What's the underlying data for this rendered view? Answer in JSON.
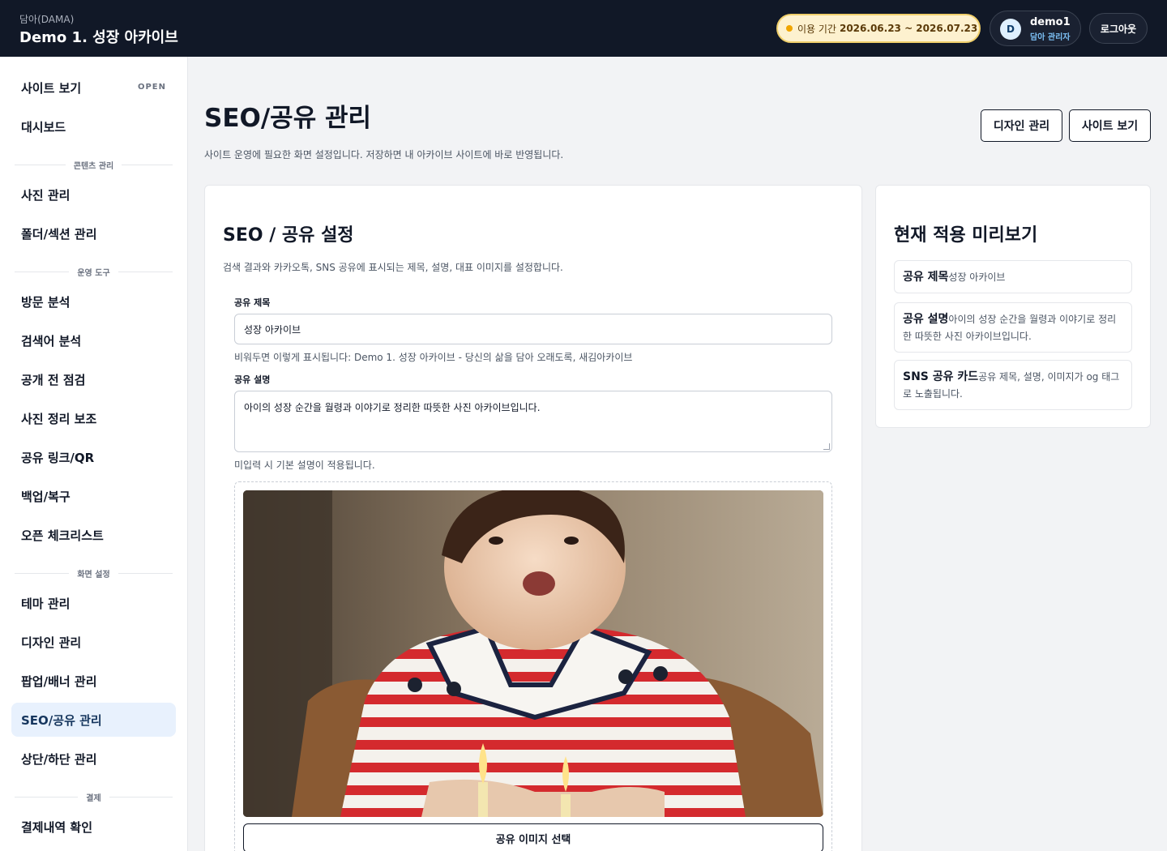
{
  "header": {
    "brand_sub": "담아(DAMA)",
    "brand_title": "Demo 1. 성장 아카이브",
    "period_label": "이용 기간",
    "period_dates": "2026.06.23 ~ 2026.07.23",
    "user_initial": "D",
    "user_name": "demo1",
    "user_role": "담아 관리자",
    "logout_label": "로그아웃"
  },
  "sidebar": {
    "site_view": "사이트 보기",
    "site_view_badge": "OPEN",
    "dashboard": "대시보드",
    "sections": {
      "content": "콘텐츠 관리",
      "tools": "운영 도구",
      "display": "화면 설정",
      "payment": "결제"
    },
    "items": {
      "photos": "사진 관리",
      "folders": "폴더/섹션 관리",
      "visits": "방문 분석",
      "search_terms": "검색어 분석",
      "prelaunch": "공개 전 점검",
      "photo_helper": "사진 정리 보조",
      "share_link": "공유 링크/QR",
      "backup": "백업/복구",
      "open_checklist": "오픈 체크리스트",
      "theme": "테마 관리",
      "design": "디자인 관리",
      "popup": "팝업/배너 관리",
      "seo": "SEO/공유 관리",
      "header_footer": "상단/하단 관리",
      "billing": "결제내역 확인"
    },
    "active": "seo"
  },
  "main": {
    "title": "SEO/공유 관리",
    "description": "사이트 운영에 필요한 화면 설정입니다. 저장하면 내 아카이브 사이트에 바로 반영됩니다.",
    "design_button": "디자인 관리",
    "site_button": "사이트 보기"
  },
  "seo_card": {
    "title": "SEO / 공유 설정",
    "description": "검색 결과와 카카오톡, SNS 공유에 표시되는 제목, 설명, 대표 이미지를 설정합니다.",
    "share_title_label": "공유 제목",
    "share_title_value": "성장 아카이브",
    "share_title_hint": "비워두면 이렇게 표시됩니다: Demo 1. 성장 아카이브 - 당신의 삶을 담아 오래도록, 새김아카이브",
    "share_desc_label": "공유 설명",
    "share_desc_value": "아이의 성장 순간을 월령과 이야기로 정리한 따뜻한 사진 아카이브입니다.",
    "share_desc_hint": "미입력 시 기본 설명이 적용됩니다.",
    "select_image_button": "공유 이미지 선택"
  },
  "preview_card": {
    "title": "현재 적용 미리보기",
    "items": [
      {
        "key": "공유 제목",
        "value": "성장 아카이브"
      },
      {
        "key": "공유 설명",
        "value": "아이의 성장 순간을 월령과 이야기로 정리한 따뜻한 사진 아카이브입니다."
      },
      {
        "key": "SNS 공유 카드",
        "value": "공유 제목, 설명, 이미지가 og 태그로 노출됩니다."
      }
    ]
  },
  "colors": {
    "topbar": "#111827",
    "accent_active": "#e8f1fd",
    "period_badge": "#fdf1cf",
    "border": "#e5e7eb"
  }
}
